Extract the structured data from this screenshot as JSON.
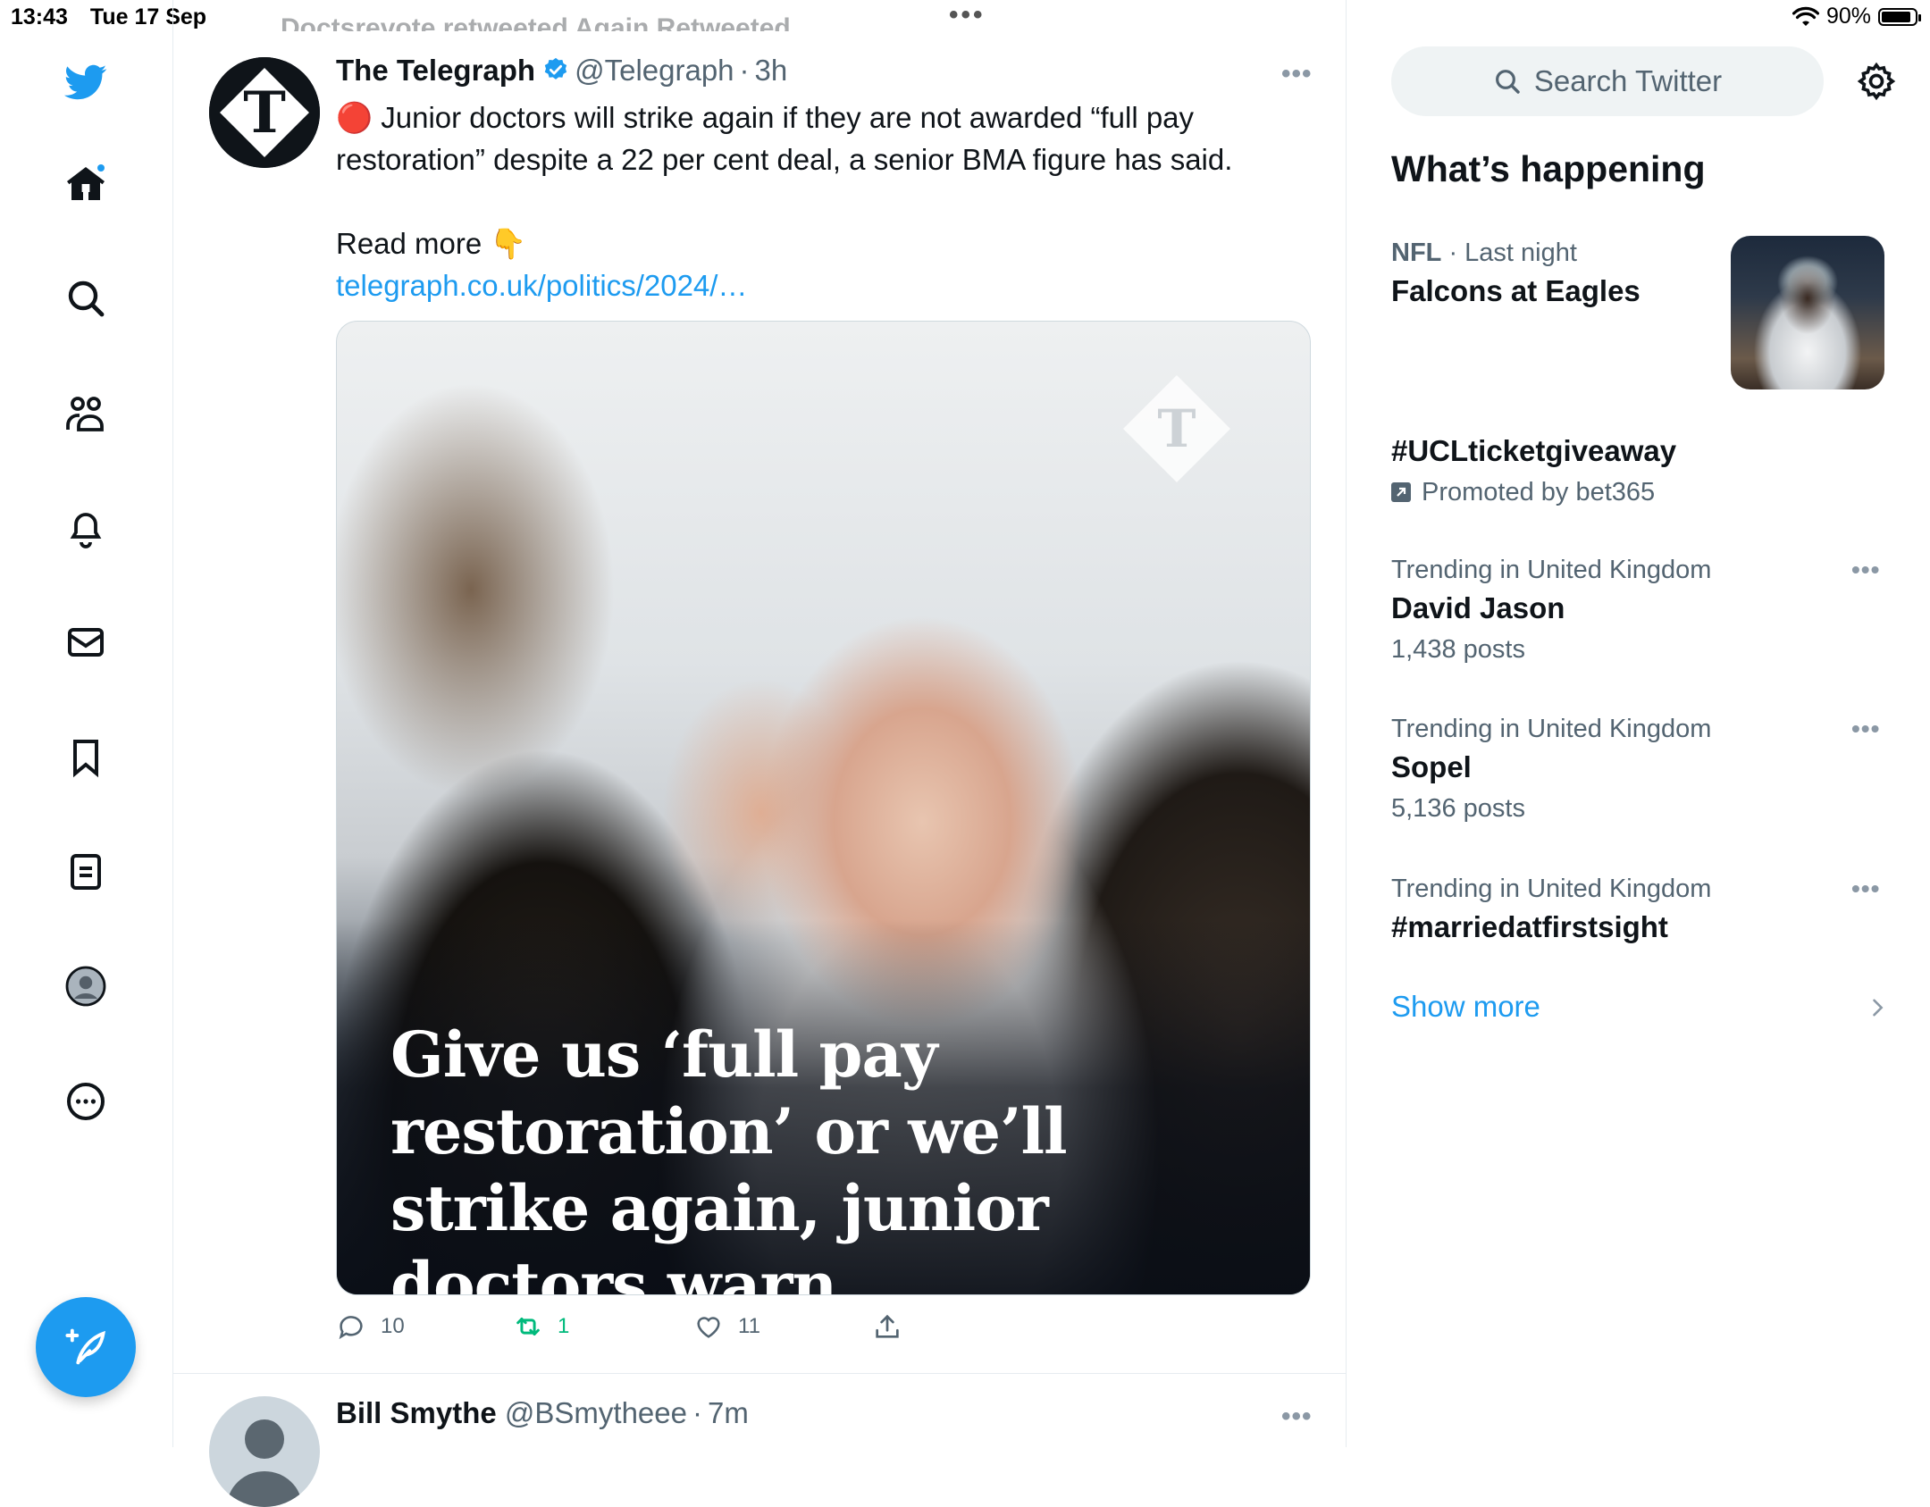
{
  "status_bar": {
    "time": "13:43",
    "date": "Tue 17 Sep",
    "battery": "90%",
    "battery_level": 0.9
  },
  "left_nav": {
    "items": [
      {
        "icon": "twitter-bird-icon"
      },
      {
        "icon": "home-icon",
        "notification_dot": true
      },
      {
        "icon": "search-icon"
      },
      {
        "icon": "communities-icon"
      },
      {
        "icon": "notifications-bell-icon"
      },
      {
        "icon": "messages-envelope-icon"
      },
      {
        "icon": "bookmarks-icon"
      },
      {
        "icon": "lists-icon"
      },
      {
        "icon": "profile-avatar-icon"
      },
      {
        "icon": "more-options-icon"
      }
    ],
    "compose_icon": "compose-tweet-icon",
    "accent_color": "#1d9bf0"
  },
  "timeline": {
    "previous_tweet_fragment": "Doctsrevote retweeted Again Retweeted",
    "tweets": [
      {
        "name": "The Telegraph",
        "verified": true,
        "handle": "@Telegraph",
        "separator": "·",
        "time": "3h",
        "text_line1": "🔴 Junior doctors will strike again if they are not awarded “full pay restoration” despite a 22 per cent deal, a senior BMA figure has said.",
        "read_more": "Read more 👇",
        "link": "telegraph.co.uk/politics/2024/…",
        "media_headline": "Give us ‘full pay restoration’ or we’ll strike again, junior doctors warn",
        "media_logo_letter": "T",
        "replies": "10",
        "retweets": "1",
        "likes": "11"
      },
      {
        "name": "Bill Smythe",
        "handle": "@BSmytheee",
        "separator": "·",
        "time": "7m"
      }
    ]
  },
  "sidebar": {
    "search_placeholder": "Search Twitter",
    "section_title": "What’s happening",
    "trends": [
      {
        "category": "NFL",
        "context": "· Last night",
        "title": "Falcons at Eagles"
      },
      {
        "title": "#UCLticketgiveaway",
        "promoted": "Promoted by bet365"
      },
      {
        "context": "Trending in United Kingdom",
        "title": "David Jason",
        "count": "1,438 posts"
      },
      {
        "context": "Trending in United Kingdom",
        "title": "Sopel",
        "count": "5,136 posts"
      },
      {
        "context": "Trending in United Kingdom",
        "title": "#marriedatfirstsight"
      }
    ],
    "show_more": "Show more"
  }
}
